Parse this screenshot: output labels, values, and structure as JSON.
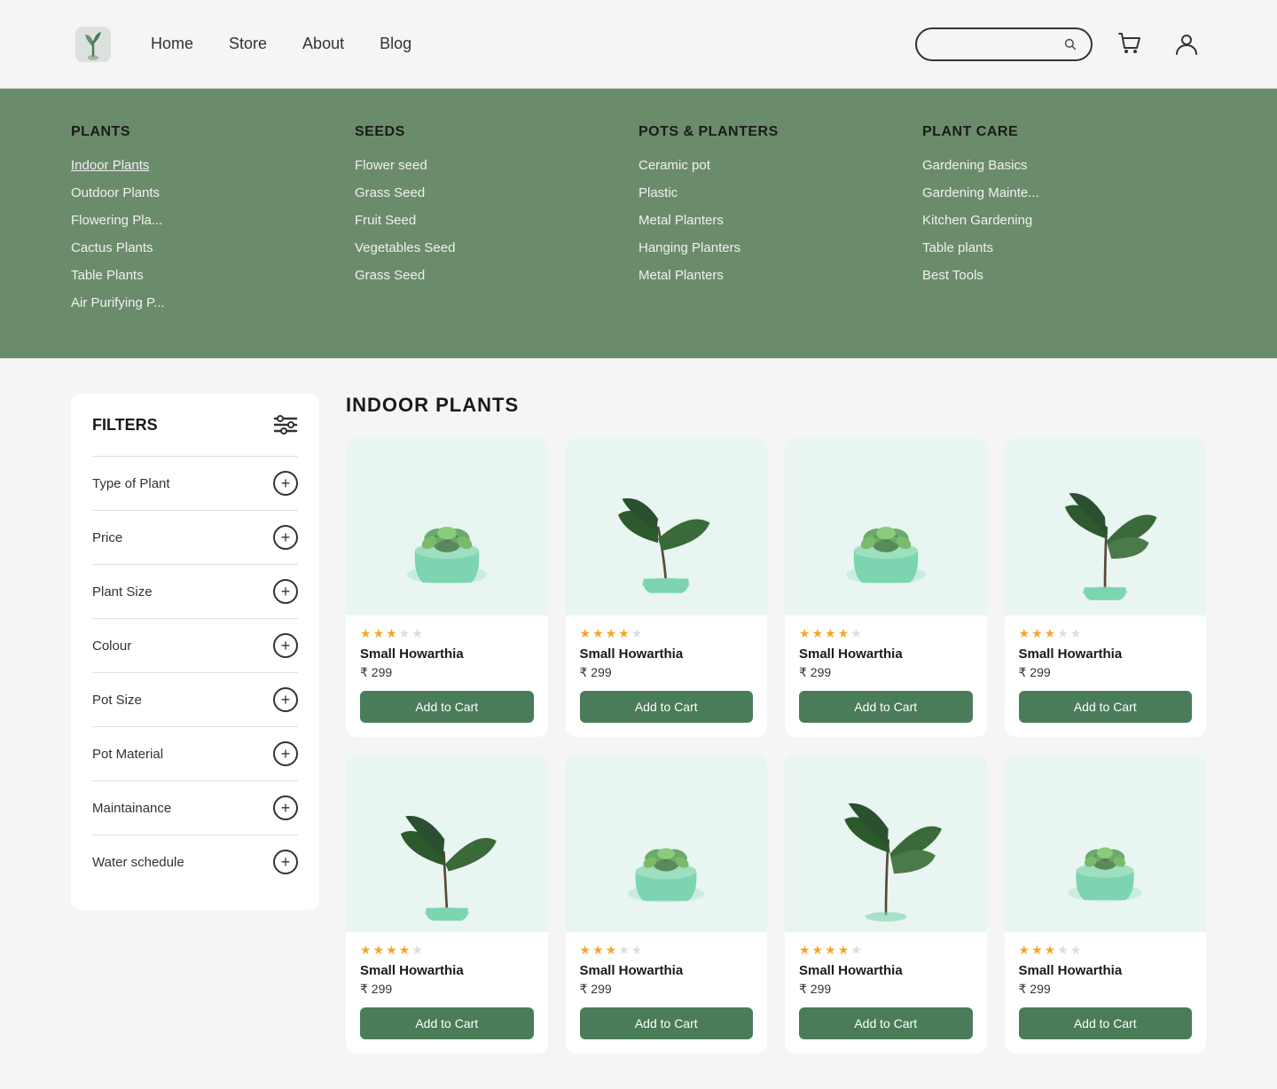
{
  "header": {
    "logo_alt": "Plant Shop Logo",
    "nav": [
      {
        "label": "Home",
        "id": "home"
      },
      {
        "label": "Store",
        "id": "store"
      },
      {
        "label": "About",
        "id": "about"
      },
      {
        "label": "Blog",
        "id": "blog"
      }
    ],
    "search_placeholder": "",
    "cart_label": "Cart",
    "user_label": "User Account"
  },
  "dropdown": {
    "columns": [
      {
        "title": "PLANTS",
        "items": [
          {
            "label": "Indoor Plants",
            "underlined": true
          },
          {
            "label": "Outdoor Plants",
            "underlined": false
          },
          {
            "label": "Flowering Pla...",
            "underlined": false
          },
          {
            "label": "Cactus Plants",
            "underlined": false
          },
          {
            "label": "Table Plants",
            "underlined": false
          },
          {
            "label": "Air Purifying P...",
            "underlined": false
          }
        ]
      },
      {
        "title": "SEEDS",
        "items": [
          {
            "label": "Flower seed",
            "underlined": false
          },
          {
            "label": "Grass Seed",
            "underlined": false
          },
          {
            "label": "Fruit Seed",
            "underlined": false
          },
          {
            "label": "Vegetables Seed",
            "underlined": false
          },
          {
            "label": "Grass Seed",
            "underlined": false
          }
        ]
      },
      {
        "title": "POTS & PLANTERS",
        "items": [
          {
            "label": "Ceramic pot",
            "underlined": false
          },
          {
            "label": "Plastic",
            "underlined": false
          },
          {
            "label": "Metal Planters",
            "underlined": false
          },
          {
            "label": "Hanging Planters",
            "underlined": false
          },
          {
            "label": "Metal Planters",
            "underlined": false
          }
        ]
      },
      {
        "title": "PLANT CARE",
        "items": [
          {
            "label": "Gardening Basics",
            "underlined": false
          },
          {
            "label": "Gardening Mainte...",
            "underlined": false
          },
          {
            "label": "Kitchen Gardening",
            "underlined": false
          },
          {
            "label": "Table plants",
            "underlined": false
          },
          {
            "label": "Best Tools",
            "underlined": false
          }
        ]
      }
    ]
  },
  "filters": {
    "title": "FILTERS",
    "items": [
      {
        "label": "Type of Plant"
      },
      {
        "label": "Price"
      },
      {
        "label": "Plant Size"
      },
      {
        "label": "Colour"
      },
      {
        "label": "Pot Size"
      },
      {
        "label": "Pot Material"
      },
      {
        "label": "Maintainance"
      },
      {
        "label": "Water schedule"
      }
    ]
  },
  "products": {
    "section_title": "INDOOR PLANTS",
    "items": [
      {
        "name": "Small Howarthia",
        "price": "₹ 299",
        "stars": 3,
        "type": "succulent",
        "row": 1
      },
      {
        "name": "Small Howarthia",
        "price": "₹ 299",
        "stars": 4,
        "type": "largeleaf",
        "row": 1
      },
      {
        "name": "Small Howarthia",
        "price": "₹ 299",
        "stars": 4,
        "type": "succulent",
        "row": 1
      },
      {
        "name": "Small Howarthia",
        "price": "₹ 299",
        "stars": 3,
        "type": "largeleaf",
        "row": 1
      },
      {
        "name": "Small Howarthia",
        "price": "₹ 299",
        "stars": 4,
        "type": "largeleaf",
        "row": 2
      },
      {
        "name": "Small Howarthia",
        "price": "₹ 299",
        "stars": 3,
        "type": "succulent",
        "row": 2
      },
      {
        "name": "Small Howarthia",
        "price": "₹ 299",
        "stars": 4,
        "type": "largeleaf_tall",
        "row": 2
      },
      {
        "name": "Small Howarthia",
        "price": "₹ 299",
        "stars": 3,
        "type": "succulent",
        "row": 2
      }
    ],
    "add_to_cart_label": "Add to Cart"
  }
}
